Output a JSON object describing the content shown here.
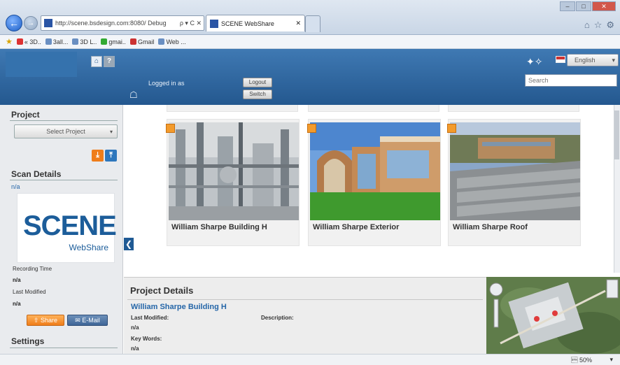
{
  "browser": {
    "address": "http://scene.bsdesign.com:8080/  Debug",
    "address_icons": "ρ ▾ C ✕",
    "tabs": [
      {
        "label": "SCENE WebShare",
        "close": "✕"
      }
    ],
    "favorites": [
      {
        "label": "« 3D..",
        "color": "#d33"
      },
      {
        "label": "3all...",
        "color": "#6a8fc2"
      },
      {
        "label": "3D L..",
        "color": "#6a8fc2"
      },
      {
        "label": "gmai..",
        "color": "#3a3"
      },
      {
        "label": "Gmail",
        "color": "#c33"
      },
      {
        "label": "Web ...",
        "color": "#6a8fc2"
      }
    ],
    "zoom": "\u0002 50%"
  },
  "header": {
    "logged_in_label": "Logged in as",
    "logout_label": "Logout",
    "switch_label": "Switch",
    "language": "English",
    "search_placeholder": "Search"
  },
  "sidebar": {
    "project_heading": "Project",
    "select_project": "Select Project",
    "scan_details_heading": "Scan Details",
    "scan_value": "n/a",
    "logo_big": "SCENE",
    "logo_small": "WebShare",
    "recording_time_label": "Recording Time",
    "recording_time_value": "n/a",
    "last_modified_label": "Last Modified",
    "last_modified_value": "n/a",
    "share_label": "Share",
    "email_label": "E-Mail",
    "settings_heading": "Settings"
  },
  "projects": [
    {
      "title": "William Sharpe Building H"
    },
    {
      "title": "William Sharpe Exterior"
    },
    {
      "title": "William Sharpe Roof"
    }
  ],
  "details": {
    "heading": "Project Details",
    "project_name": "William Sharpe Building H",
    "last_modified_label": "Last Modified:",
    "last_modified_value": "n/a",
    "description_label": "Description:",
    "key_words_label": "Key Words:",
    "key_words_value": "n/a"
  },
  "colors": {
    "header_blue": "#2d6399",
    "accent_orange": "#f39b2c",
    "link_blue": "#2566a8"
  }
}
